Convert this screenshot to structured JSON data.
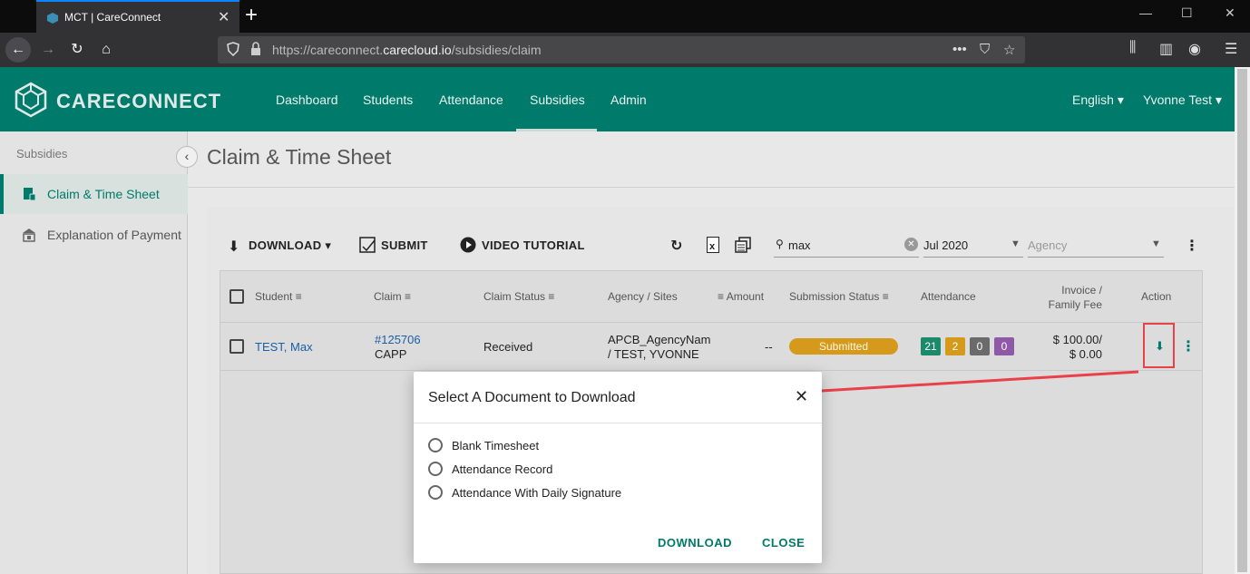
{
  "browser": {
    "tab_title": "MCT | CareConnect",
    "url_prefix": "https://careconnect.",
    "url_domain": "carecloud.io",
    "url_path": "/subsidies/claim"
  },
  "header": {
    "brand": "CARECONNECT",
    "menu": [
      "Dashboard",
      "Students",
      "Attendance",
      "Subsidies",
      "Admin"
    ],
    "language": "English",
    "user": "Yvonne Test"
  },
  "sidebar": {
    "heading": "Subsidies",
    "items": [
      {
        "label": "Claim & Time Sheet",
        "icon": "document-icon",
        "active": true
      },
      {
        "label": "Explanation of Payment",
        "icon": "bank-icon",
        "active": false
      }
    ]
  },
  "page": {
    "title": "Claim & Time Sheet"
  },
  "toolbar": {
    "download": "DOWNLOAD",
    "submit": "SUBMIT",
    "video_tutorial": "VIDEO TUTORIAL",
    "search_value": "max",
    "month_value": "Jul 2020",
    "agency_placeholder": "Agency"
  },
  "table": {
    "headers": {
      "student": "Student",
      "claim": "Claim",
      "claim_status": "Claim Status",
      "agency_sites": "Agency / Sites",
      "amount": "Amount",
      "submission_status": "Submission Status",
      "attendance": "Attendance",
      "invoice_line1": "Invoice /",
      "invoice_line2": "Family Fee",
      "action": "Action"
    },
    "rows": [
      {
        "student": "TEST, Max",
        "claim_number": "#125706",
        "claim_program": "CAPP",
        "claim_status": "Received",
        "agency_line1": "APCB_AgencyNam",
        "agency_line2": "/ TEST, YVONNE",
        "amount": "--",
        "submission_status": "Submitted",
        "attendance": [
          {
            "value": "21",
            "color": "#1b8a6a"
          },
          {
            "value": "2",
            "color": "#d59a1b"
          },
          {
            "value": "0",
            "color": "#6b6b6b"
          },
          {
            "value": "0",
            "color": "#8e5aa8"
          }
        ],
        "invoice": "$ 100.00/",
        "family_fee": "$ 0.00"
      }
    ]
  },
  "modal": {
    "title": "Select A Document to Download",
    "options": [
      "Blank Timesheet",
      "Attendance Record",
      "Attendance With Daily Signature"
    ],
    "download": "DOWNLOAD",
    "close": "CLOSE"
  },
  "colors": {
    "brand": "#007a6a",
    "annotation": "#e8414a"
  }
}
